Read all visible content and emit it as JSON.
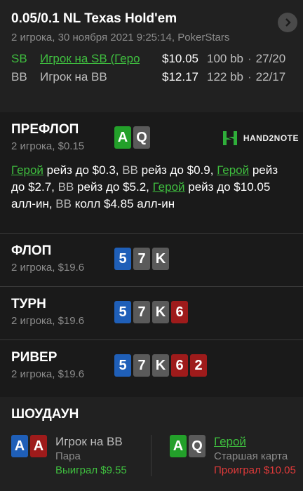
{
  "header": {
    "title": "0.05/0.1 NL Texas Hold'em",
    "subtitle": "2 игрока, 30 ноября 2021 9:25:14, PokerStars",
    "players": [
      {
        "pos": "SB",
        "name": "Игрок на SB (Геро",
        "stack": "$10.05",
        "bb": "100 bb",
        "cards": "27/20"
      },
      {
        "pos": "BB",
        "name": "Игрок на BB",
        "stack": "$12.17",
        "bb": "122 bb",
        "cards": "22/17"
      }
    ],
    "sep": "·"
  },
  "preflop": {
    "title": "ПРЕФЛОП",
    "sub": "2 игрока, $0.15",
    "cards": [
      "A",
      "Q"
    ],
    "logo": "HAND2NOTE",
    "actions": [
      {
        "who": "Герой",
        "act": " рейз до $0.3, "
      },
      {
        "who": "BB",
        "act": " рейз до $0.9, "
      },
      {
        "who": "Герой",
        "act": " рейз до $2.7, "
      },
      {
        "who": "BB",
        "act": " рейз до $5.2, "
      },
      {
        "who": "Герой",
        "act": " рейз до $10.05 алл-ин, "
      },
      {
        "who": "BB",
        "act": " колл $4.85 алл-ин"
      }
    ]
  },
  "flop": {
    "title": "ФЛОП",
    "sub": "2 игрока, $19.6",
    "cards": [
      "5",
      "7",
      "K"
    ]
  },
  "turn": {
    "title": "ТУРН",
    "sub": "2 игрока, $19.6",
    "cards": [
      "5",
      "7",
      "K",
      "6"
    ]
  },
  "river": {
    "title": "РИВЕР",
    "sub": "2 игрока, $19.6",
    "cards": [
      "5",
      "7",
      "K",
      "6",
      "2"
    ]
  },
  "showdown": {
    "title": "ШОУДАУН",
    "left": {
      "cards": [
        "A",
        "A"
      ],
      "name": "Игрок на BB",
      "hand": "Пара",
      "result": "Выиграл $9.55"
    },
    "right": {
      "cards": [
        "A",
        "Q"
      ],
      "name": "Герой",
      "hand": "Старшая карта",
      "result": "Проиграл $10.05"
    }
  },
  "colors": {
    "green": "#3fbf3f",
    "red": "#e03a3a",
    "card_green": "#23a02a",
    "card_blue": "#1f5fb8",
    "card_red": "#9e1b1b",
    "card_grey": "#5a5a5a"
  }
}
